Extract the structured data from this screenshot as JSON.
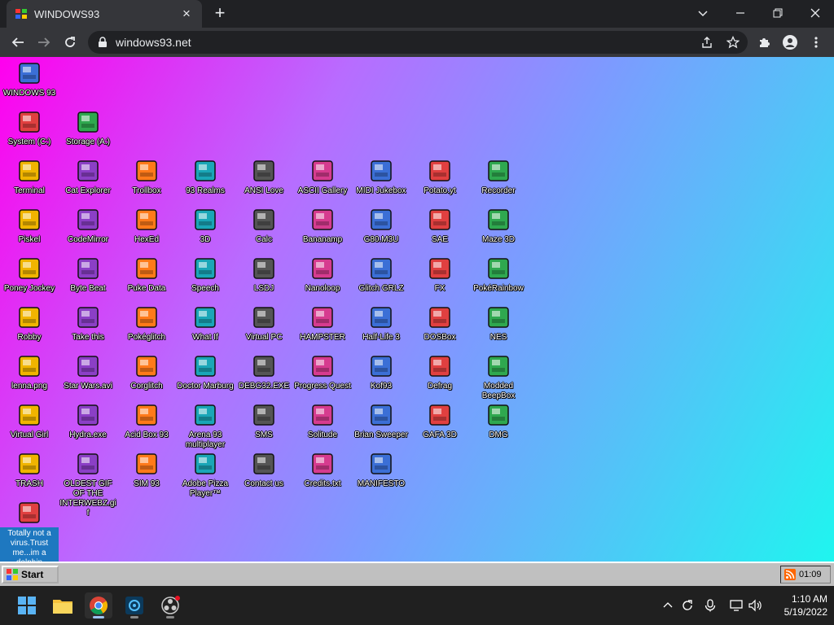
{
  "browser": {
    "tab_title": "WINDOWS93",
    "url": "windows93.net",
    "accent": "#35363a"
  },
  "desktop": {
    "icons": [
      {
        "label": "WINDOWS 93",
        "icon": "computer-icon"
      },
      {
        "label": "System (C:)",
        "icon": "hard-drive-icon"
      },
      {
        "label": "Storage (A:)",
        "icon": "floppy-drive-icon"
      },
      {
        "label": "Terminal",
        "icon": "terminal-icon"
      },
      {
        "label": "Cat Explorer",
        "icon": "globe-cat-icon"
      },
      {
        "label": "Trollbox",
        "icon": "chat-bubble-icon"
      },
      {
        "label": "93 Realms",
        "icon": "dragon-icon"
      },
      {
        "label": "ANSI Love",
        "icon": "letter-a-icon"
      },
      {
        "label": "ASCII Gallery",
        "icon": "numbers-icon"
      },
      {
        "label": "MIDI Jukebox",
        "icon": "piano-keys-icon"
      },
      {
        "label": "Potato.yt",
        "icon": "potato-icon"
      },
      {
        "label": "Recorder",
        "icon": "microphone-icon"
      },
      {
        "label": "Piskel",
        "icon": "palette-icon"
      },
      {
        "label": "CodeMirror",
        "icon": "cat-paw-icon"
      },
      {
        "label": "HexEd",
        "icon": "cube-icon"
      },
      {
        "label": "3D",
        "icon": "teapot-icon"
      },
      {
        "label": "Calc",
        "icon": "calculator-icon"
      },
      {
        "label": "Bananamp",
        "icon": "banana-icon"
      },
      {
        "label": "G80.M3U",
        "icon": "speaker-file-icon"
      },
      {
        "label": "SAE",
        "icon": "amiga-ball-icon"
      },
      {
        "label": "Maze 3D",
        "icon": "maze-icon"
      },
      {
        "label": "Poney Jockey",
        "icon": "pony-icon"
      },
      {
        "label": "Byte Beat",
        "icon": "byte-beat-icon"
      },
      {
        "label": "Puke Data",
        "icon": "puke-data-icon"
      },
      {
        "label": "Speech",
        "icon": "speech-face-icon"
      },
      {
        "label": "LSDJ",
        "icon": "gameboy-icon"
      },
      {
        "label": "Nanoloop",
        "icon": "waveform-icon"
      },
      {
        "label": "Glitch GRLZ",
        "icon": "lips-icon"
      },
      {
        "label": "FX",
        "icon": "atom-icon"
      },
      {
        "label": "PokéRainbow",
        "icon": "pokemon-trainers-icon"
      },
      {
        "label": "Robby",
        "icon": "stick-figure-icon"
      },
      {
        "label": "Take this",
        "icon": "bearded-man-icon"
      },
      {
        "label": "Pokéglitch",
        "icon": "pokeglitch-icon"
      },
      {
        "label": "What If",
        "icon": "bars-grid-icon"
      },
      {
        "label": "Virtual PC",
        "icon": "window-cursor-icon"
      },
      {
        "label": "HAMPSTER",
        "icon": "owl-icon"
      },
      {
        "label": "Half-Life 3",
        "icon": "lambda-icon"
      },
      {
        "label": "DOSBox",
        "icon": "dos-box-icon"
      },
      {
        "label": "NES",
        "icon": "nes-console-icon"
      },
      {
        "label": "lenna.png",
        "icon": "image-file-icon"
      },
      {
        "label": "Star Wars.avi",
        "icon": "yoda-icon"
      },
      {
        "label": "Corglitch",
        "icon": "corgi-icon"
      },
      {
        "label": "Doctor Marburg",
        "icon": "doctor-icon"
      },
      {
        "label": "DEBG32.EXE",
        "icon": "debug-face-icon"
      },
      {
        "label": "Progress Quest",
        "icon": "crossed-swords-icon"
      },
      {
        "label": "Kof93",
        "icon": "fighter-icon"
      },
      {
        "label": "Defrag",
        "icon": "defrag-icon"
      },
      {
        "label": "Modded BeepBox",
        "icon": "green-ring-icon"
      },
      {
        "label": "Virtual Girl",
        "icon": "girl-face-icon"
      },
      {
        "label": "Hydra.exe",
        "icon": "hydra-icon"
      },
      {
        "label": "Acid Box 93",
        "icon": "smiley-icon"
      },
      {
        "label": "Arena 93 multiplayer",
        "icon": "color-cube-icon"
      },
      {
        "label": "SMS",
        "icon": "sega-console-icon"
      },
      {
        "label": "Solitude",
        "icon": "bottle-icon"
      },
      {
        "label": "Brian Sweeper",
        "icon": "mine-icon"
      },
      {
        "label": "GAFA 3D",
        "icon": "doom-face-icon"
      },
      {
        "label": "DMG",
        "icon": "gameboy-cart-icon"
      },
      {
        "label": "TRASH",
        "icon": "trash-icon"
      },
      {
        "label": "OLDEST GIF OF THE INTERWEBZ.gif",
        "icon": "gif-file-icon"
      },
      {
        "label": "SIM 93",
        "icon": "book-icon"
      },
      {
        "label": "Adobe Pizza Player™",
        "icon": "pizza-icon"
      },
      {
        "label": "Contact us",
        "icon": "mail-pen-icon"
      },
      {
        "label": "Credits.txt",
        "icon": "text-file-icon"
      },
      {
        "label": "MANIFESTO",
        "icon": "question-mark-icon"
      },
      {
        "label": "",
        "icon": "dolphin-icon"
      }
    ],
    "virus_text": "Totally not a virus.Trust me...im a dolphin"
  },
  "taskbar93": {
    "start_label": "Start",
    "clock": "01:09"
  },
  "windows_taskbar": {
    "time": "1:10 AM",
    "date": "5/19/2022"
  }
}
